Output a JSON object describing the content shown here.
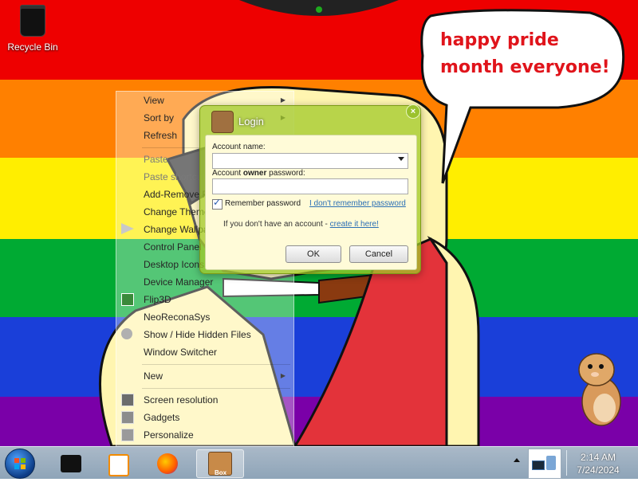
{
  "desktop": {
    "icons": [
      {
        "label": "Recycle Bin",
        "icon": "recycle-bin-icon"
      }
    ],
    "bubble_text": "happy pride month everyone!",
    "colors": {
      "red": "#ee0000",
      "orange": "#ff7f00",
      "yellow": "#ffee00",
      "green": "#00aa33",
      "blue": "#1a3fd9",
      "purple": "#7a00a8"
    }
  },
  "context_menu": {
    "items": [
      {
        "label": "View",
        "submenu": true
      },
      {
        "label": "Sort by",
        "submenu": true
      },
      {
        "label": "Refresh"
      },
      {
        "label": "Paste"
      },
      {
        "label": "Paste shortcut"
      },
      {
        "label": "Add-Remove Programs"
      },
      {
        "label": "Change Theme"
      },
      {
        "label": "Change Wallpaper"
      },
      {
        "label": "Control Panel"
      },
      {
        "label": "Desktop Icons Settings"
      },
      {
        "label": "Device Manager"
      },
      {
        "label": "Flip3D"
      },
      {
        "label": "NeoReconaSys"
      },
      {
        "label": "Show / Hide Hidden Files"
      },
      {
        "label": "Window Switcher"
      },
      {
        "label": "New",
        "submenu": true
      },
      {
        "label": "Screen resolution"
      },
      {
        "label": "Gadgets"
      },
      {
        "label": "Personalize"
      }
    ]
  },
  "login": {
    "title": "Login",
    "account_name_label": "Account name:",
    "account_name_value": "",
    "password_label_pre": "Account ",
    "password_label_bold": "owner",
    "password_label_post": " password:",
    "password_value": "",
    "remember_label": "Remember password",
    "remember_checked": true,
    "forgot_link": "I don't remember password",
    "no_account_text": "If you don't have an account - ",
    "create_link": "create it here!",
    "ok_label": "OK",
    "cancel_label": "Cancel",
    "close_symbol": "×"
  },
  "taskbar": {
    "apps": [
      {
        "name": "black-app-icon",
        "active": false
      },
      {
        "name": "media-player-icon",
        "active": false
      },
      {
        "name": "firefox-icon",
        "active": false
      },
      {
        "name": "hamster-box-icon",
        "active": true,
        "caption": "Box"
      }
    ],
    "time": "2:14 AM",
    "date": "7/24/2024"
  }
}
